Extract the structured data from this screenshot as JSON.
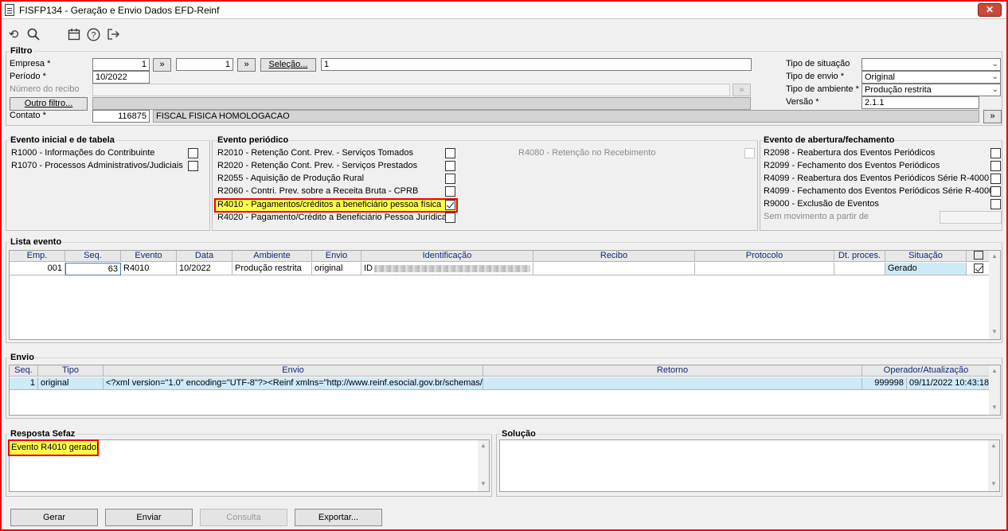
{
  "window": {
    "title": "FISFP134 - Geração e Envio Dados EFD-Reinf",
    "close_label": "✕"
  },
  "toolbar": {
    "icons": [
      "undo-icon",
      "search-icon",
      "calendar-icon",
      "help-icon",
      "exit-icon"
    ]
  },
  "filtro": {
    "title": "Filtro",
    "empresa_label": "Empresa *",
    "empresa_from": "1",
    "empresa_to": "1",
    "selecao_label": "Seleção...",
    "selecao_value": "1",
    "periodo_label": "Período *",
    "periodo_value": "10/2022",
    "recibo_label": "Número do recibo",
    "recibo_value": "",
    "outro_filtro_label": "Outro filtro...",
    "contato_label": "Contato *",
    "contato_code": "116875",
    "contato_name": "FISCAL FISICA HOMOLOGACAO",
    "tipo_situacao_label": "Tipo de situação",
    "tipo_situacao_value": "",
    "tipo_envio_label": "Tipo de envio *",
    "tipo_envio_value": "Original",
    "tipo_ambiente_label": "Tipo de ambiente *",
    "tipo_ambiente_value": "Produção restrita",
    "versao_label": "Versão *",
    "versao_value": "2.1.1",
    "arrow": "»"
  },
  "evento_inicial": {
    "title": "Evento inicial e de tabela",
    "items": [
      {
        "label": "R1000 - Informações do Contribuinte",
        "checked": false
      },
      {
        "label": "R1070 - Processos Administrativos/Judiciais",
        "checked": false
      }
    ]
  },
  "evento_periodico": {
    "title": "Evento periódico",
    "items": [
      {
        "label": "R2010 - Retenção Cont. Prev. - Serviços Tomados",
        "checked": false
      },
      {
        "label": "R2020 - Retenção Cont. Prev. - Serviços Prestados",
        "checked": false
      },
      {
        "label": "R2055 - Aquisição de Produção Rural",
        "checked": false
      },
      {
        "label": "R2060 - Contri. Prev. sobre a Receita Bruta - CPRB",
        "checked": false
      },
      {
        "label": "R4010 - Pagamentos/créditos a beneficiário pessoa física",
        "checked": true
      },
      {
        "label": "R4020 - Pagamento/Crédito a Beneficiário Pessoa Jurídica",
        "checked": false
      }
    ],
    "r4080_label": "R4080 - Retenção no Recebimento"
  },
  "evento_abertura": {
    "title": "Evento de abertura/fechamento",
    "items": [
      {
        "label": "R2098 - Reabertura dos Eventos Periódicos",
        "checked": false
      },
      {
        "label": "R2099 - Fechamento dos Eventos Periódicos",
        "checked": false
      },
      {
        "label": "R4099 - Reabertura dos Eventos Periódicos Série R-4000",
        "checked": false
      },
      {
        "label": "R4099 - Fechamento dos Eventos Periódicos Série R-4000",
        "checked": false
      },
      {
        "label": "R9000 - Exclusão de Eventos",
        "checked": false
      }
    ],
    "sem_movimento_label": "Sem movimento a partir de"
  },
  "lista_evento": {
    "title": "Lista evento",
    "columns": [
      "Emp.",
      "Seq.",
      "Evento",
      "Data",
      "Ambiente",
      "Envio",
      "Identificação",
      "Recibo",
      "Protocolo",
      "Dt. proces.",
      "Situação"
    ],
    "rows": [
      {
        "emp": "001",
        "seq": "63",
        "evento": "R4010",
        "data": "10/2022",
        "ambiente": "Produção restrita",
        "envio": "original",
        "identificacao": "ID",
        "recibo": "",
        "protocolo": "",
        "dt_proces": "",
        "situacao": "Gerado",
        "checked": true
      }
    ]
  },
  "envio": {
    "title": "Envio",
    "columns": [
      "Seq.",
      "Tipo",
      "Envio",
      "Retorno",
      "Operador/Atualização"
    ],
    "rows": [
      {
        "seq": "1",
        "tipo": "original",
        "envio": "<?xml version=\"1.0\" encoding=\"UTF-8\"?><Reinf xmlns=\"http://www.reinf.esocial.gov.br/schemas/",
        "retorno": "",
        "operador": "999998",
        "atualizacao": "09/11/2022 10:43:18"
      }
    ]
  },
  "resposta": {
    "title": "Resposta Sefaz",
    "text": "Evento R4010 gerado!"
  },
  "solucao": {
    "title": "Solução",
    "text": ""
  },
  "buttons": {
    "gerar": "Gerar",
    "enviar": "Enviar",
    "consulta": "Consulta",
    "exportar": "Exportar..."
  }
}
